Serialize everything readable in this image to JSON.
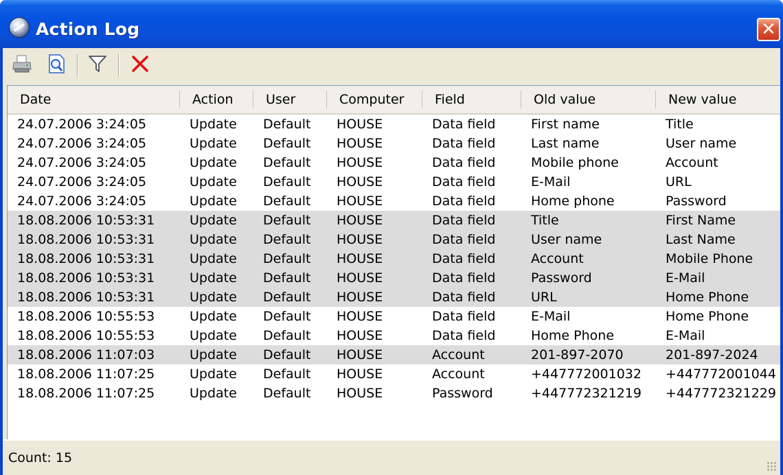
{
  "window": {
    "title": "Action Log",
    "close_glyph": "✕"
  },
  "toolbar": {
    "buttons": [
      {
        "name": "print-button",
        "icon": "printer-icon"
      },
      {
        "name": "print-preview-button",
        "icon": "print-preview-icon"
      },
      {
        "name": "filter-button",
        "icon": "filter-icon"
      },
      {
        "name": "delete-button",
        "icon": "delete-icon"
      }
    ]
  },
  "table": {
    "columns": [
      "Date",
      "Action",
      "User",
      "Computer",
      "Field",
      "Old value",
      "New value"
    ],
    "rows": [
      {
        "highlight": false,
        "cells": [
          "24.07.2006 3:24:05",
          "Update",
          "Default",
          "HOUSE",
          "Data field",
          "First name",
          "Title"
        ]
      },
      {
        "highlight": false,
        "cells": [
          "24.07.2006 3:24:05",
          "Update",
          "Default",
          "HOUSE",
          "Data field",
          "Last name",
          "User name"
        ]
      },
      {
        "highlight": false,
        "cells": [
          "24.07.2006 3:24:05",
          "Update",
          "Default",
          "HOUSE",
          "Data field",
          "Mobile phone",
          "Account"
        ]
      },
      {
        "highlight": false,
        "cells": [
          "24.07.2006 3:24:05",
          "Update",
          "Default",
          "HOUSE",
          "Data field",
          "E-Mail",
          "URL"
        ]
      },
      {
        "highlight": false,
        "cells": [
          "24.07.2006 3:24:05",
          "Update",
          "Default",
          "HOUSE",
          "Data field",
          "Home phone",
          "Password"
        ]
      },
      {
        "highlight": true,
        "cells": [
          "18.08.2006 10:53:31",
          "Update",
          "Default",
          "HOUSE",
          "Data field",
          "Title",
          "First Name"
        ]
      },
      {
        "highlight": true,
        "cells": [
          "18.08.2006 10:53:31",
          "Update",
          "Default",
          "HOUSE",
          "Data field",
          "User name",
          "Last Name"
        ]
      },
      {
        "highlight": true,
        "cells": [
          "18.08.2006 10:53:31",
          "Update",
          "Default",
          "HOUSE",
          "Data field",
          "Account",
          "Mobile Phone"
        ]
      },
      {
        "highlight": true,
        "cells": [
          "18.08.2006 10:53:31",
          "Update",
          "Default",
          "HOUSE",
          "Data field",
          "Password",
          "E-Mail"
        ]
      },
      {
        "highlight": true,
        "cells": [
          "18.08.2006 10:53:31",
          "Update",
          "Default",
          "HOUSE",
          "Data field",
          "URL",
          "Home Phone"
        ]
      },
      {
        "highlight": false,
        "cells": [
          "18.08.2006 10:55:53",
          "Update",
          "Default",
          "HOUSE",
          "Data field",
          "E-Mail",
          "Home Phone"
        ]
      },
      {
        "highlight": false,
        "cells": [
          "18.08.2006 10:55:53",
          "Update",
          "Default",
          "HOUSE",
          "Data field",
          "Home Phone",
          "E-Mail"
        ]
      },
      {
        "highlight": true,
        "cells": [
          "18.08.2006 11:07:03",
          "Update",
          "Default",
          "HOUSE",
          "Account",
          "201-897-2070",
          "201-897-2024"
        ]
      },
      {
        "highlight": false,
        "cells": [
          "18.08.2006 11:07:25",
          "Update",
          "Default",
          "HOUSE",
          "Account",
          "+447772001032",
          "+447772001044"
        ]
      },
      {
        "highlight": false,
        "cells": [
          "18.08.2006 11:07:25",
          "Update",
          "Default",
          "HOUSE",
          "Password",
          "+447772321219",
          "+447772321229"
        ]
      }
    ]
  },
  "status": {
    "count_text": "Count: 15"
  },
  "colors": {
    "titlebar": "#0552e0",
    "highlight_row": "#dcdcdc",
    "window_bg": "#ece9d8",
    "delete_icon": "#e01010"
  }
}
